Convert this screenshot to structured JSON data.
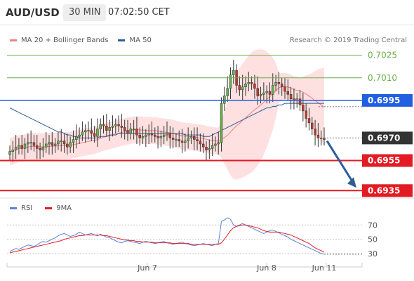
{
  "header": {
    "pair": "AUD/USD",
    "interval": "30 MIN",
    "time": "07:02:50 CET"
  },
  "legend": {
    "bollinger_label": "MA 20 + Bollinger Bands",
    "ma50_label": "MA 50",
    "research": "Research © 2019 Trading Central"
  },
  "rsi_legend": {
    "rsi_label": "RSI",
    "ma9_label": "9MA"
  },
  "colors": {
    "bollinger": "#f08080",
    "bollinger_fill": "#fdd5d5",
    "ma50": "#2f5d9a",
    "up_candle": "#6ab04c",
    "down_candle": "#c0392b",
    "wick": "#333333",
    "pivot_blue": "#1f5fe0",
    "support_red": "#e31b23",
    "resistance_green": "#6ab04c",
    "current_box": "#333333",
    "arrow": "#2f5d9a",
    "rsi": "#5b84d6",
    "rsi_ma": "#e31b23"
  },
  "chart_data": [
    {
      "type": "candlestick",
      "title": "AUD/USD 30 MIN",
      "x_ticks": [
        "Jun 7",
        "Jun 8",
        "Jun 11"
      ],
      "ylim": [
        0.693,
        0.703
      ],
      "levels": [
        {
          "value": 0.7025,
          "label": "0.7025",
          "kind": "resistance"
        },
        {
          "value": 0.701,
          "label": "0.7010",
          "kind": "resistance"
        },
        {
          "value": 0.6995,
          "label": "0.6995",
          "kind": "pivot"
        },
        {
          "value": 0.697,
          "label": "0.6970",
          "kind": "current"
        },
        {
          "value": 0.6955,
          "label": "0.6955",
          "kind": "support"
        },
        {
          "value": 0.6935,
          "label": "0.6935",
          "kind": "support"
        }
      ],
      "closes": [
        0.6961,
        0.6962,
        0.6964,
        0.6965,
        0.6963,
        0.6966,
        0.6967,
        0.6967,
        0.6965,
        0.6963,
        0.6962,
        0.6964,
        0.6966,
        0.6967,
        0.6965,
        0.6966,
        0.6968,
        0.6968,
        0.6966,
        0.6964,
        0.6967,
        0.6969,
        0.6971,
        0.6972,
        0.6974,
        0.6975,
        0.6975,
        0.6973,
        0.6971,
        0.6976,
        0.6979,
        0.6978,
        0.6975,
        0.6977,
        0.6978,
        0.6979,
        0.6978,
        0.6977,
        0.6975,
        0.6973,
        0.6976,
        0.6976,
        0.6972,
        0.697,
        0.6971,
        0.6972,
        0.6973,
        0.6972,
        0.6971,
        0.697,
        0.6971,
        0.6972,
        0.6973,
        0.697,
        0.6969,
        0.6969,
        0.6968,
        0.6967,
        0.6968,
        0.697,
        0.6971,
        0.6969,
        0.6968,
        0.6966,
        0.6964,
        0.6962,
        0.6963,
        0.6965,
        0.6966,
        0.6967,
        0.6993,
        0.6998,
        0.7003,
        0.7012,
        0.7015,
        0.7005,
        0.7002,
        0.7004,
        0.7006,
        0.7007,
        0.7006,
        0.7003,
        0.6998,
        0.6999,
        0.7,
        0.7001,
        0.6999,
        0.7005,
        0.7007,
        0.7006,
        0.7004,
        0.7001,
        0.6999,
        0.6996,
        0.6995,
        0.6996,
        0.6992,
        0.6988,
        0.6983,
        0.698,
        0.6976,
        0.6972,
        0.697,
        0.697,
        0.6969
      ],
      "ma50": [
        0.699,
        0.6989,
        0.6988,
        0.6987,
        0.6986,
        0.6985,
        0.6984,
        0.6983,
        0.6982,
        0.6981,
        0.698,
        0.6979,
        0.6978,
        0.6977,
        0.6976,
        0.6975,
        0.6974,
        0.6974,
        0.6973,
        0.6972,
        0.6972,
        0.6971,
        0.6971,
        0.697,
        0.697,
        0.697,
        0.697,
        0.697,
        0.697,
        0.697,
        0.6971,
        0.6971,
        0.6971,
        0.6972,
        0.6972,
        0.6972,
        0.6973,
        0.6973,
        0.6973,
        0.6973,
        0.6973,
        0.6973,
        0.6973,
        0.6973,
        0.6973,
        0.6973,
        0.6973,
        0.6973,
        0.6973,
        0.6973,
        0.6973,
        0.6973,
        0.6973,
        0.6973,
        0.6973,
        0.6973,
        0.6973,
        0.6973,
        0.6972,
        0.6972,
        0.6972,
        0.6972,
        0.6972,
        0.6972,
        0.6971,
        0.6971,
        0.6971,
        0.6972,
        0.6973,
        0.6974,
        0.6975,
        0.6976,
        0.6977,
        0.6978,
        0.6979,
        0.698,
        0.6981,
        0.6982,
        0.6983,
        0.6984,
        0.6985,
        0.6986,
        0.6987,
        0.6988,
        0.6989,
        0.699,
        0.699,
        0.6991,
        0.6991,
        0.6992,
        0.6992,
        0.6993,
        0.6993,
        0.6993,
        0.6993,
        0.6993,
        0.6993,
        0.6993,
        0.6993,
        0.6993,
        0.6993,
        0.6993,
        0.6993,
        0.6993,
        0.6993
      ],
      "forecast_arrow": {
        "from": 0.6969,
        "to": 0.6935
      }
    },
    {
      "type": "line",
      "title": "RSI",
      "ylim": [
        25,
        85
      ],
      "y_ticks": [
        30,
        50,
        70
      ],
      "series": [
        {
          "name": "RSI",
          "values": [
            33,
            35,
            37,
            36,
            38,
            40,
            42,
            41,
            40,
            42,
            45,
            47,
            46,
            48,
            50,
            52,
            55,
            57,
            58,
            56,
            54,
            55,
            57,
            60,
            58,
            56,
            57,
            58,
            56,
            55,
            57,
            55,
            53,
            52,
            50,
            48,
            46,
            45,
            47,
            48,
            47,
            46,
            45,
            44,
            46,
            47,
            46,
            45,
            44,
            45,
            46,
            47,
            45,
            44,
            43,
            44,
            45,
            46,
            44,
            43,
            42,
            41,
            42,
            43,
            44,
            43,
            42,
            41,
            43,
            44,
            75,
            77,
            80,
            78,
            70,
            68,
            70,
            72,
            70,
            68,
            66,
            64,
            62,
            60,
            58,
            60,
            62,
            63,
            61,
            59,
            57,
            55,
            53,
            50,
            48,
            46,
            44,
            42,
            40,
            38,
            36,
            34,
            32,
            30,
            29
          ]
        },
        {
          "name": "9MA",
          "values": [
            31,
            32,
            33,
            34,
            35,
            36,
            37,
            38,
            39,
            40,
            41,
            42,
            43,
            44,
            45,
            46,
            47,
            48,
            50,
            51,
            52,
            53,
            54,
            55,
            55,
            56,
            56,
            56,
            56,
            56,
            56,
            55,
            55,
            54,
            53,
            52,
            51,
            50,
            49,
            49,
            48,
            48,
            47,
            47,
            46,
            46,
            46,
            46,
            45,
            45,
            45,
            45,
            45,
            45,
            44,
            44,
            44,
            44,
            44,
            44,
            43,
            43,
            43,
            43,
            43,
            43,
            43,
            43,
            43,
            43,
            45,
            50,
            56,
            62,
            66,
            68,
            69,
            70,
            70,
            69,
            68,
            67,
            66,
            64,
            62,
            61,
            60,
            60,
            60,
            60,
            59,
            58,
            57,
            56,
            54,
            52,
            50,
            48,
            46,
            44,
            41,
            38,
            36,
            34,
            32
          ]
        }
      ]
    }
  ]
}
